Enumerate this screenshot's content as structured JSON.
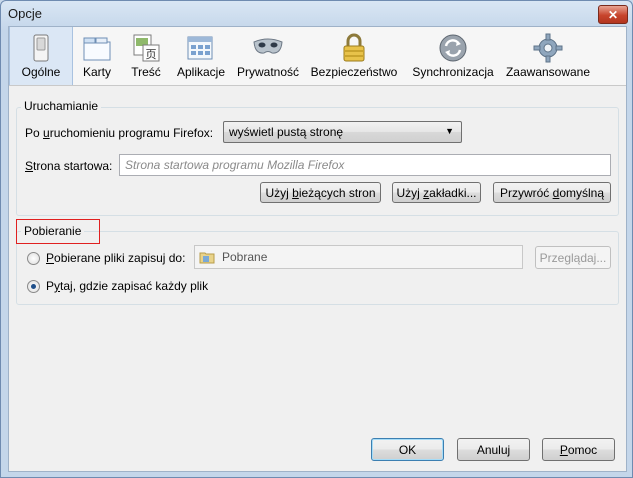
{
  "window": {
    "title": "Opcje"
  },
  "toolbar": {
    "panes": [
      {
        "label": "Ogólne",
        "icon": "switch-icon",
        "selected": true
      },
      {
        "label": "Karty",
        "icon": "tabs-icon"
      },
      {
        "label": "Treść",
        "icon": "content-icon"
      },
      {
        "label": "Aplikacje",
        "icon": "applications-icon"
      },
      {
        "label": "Prywatność",
        "icon": "mask-icon"
      },
      {
        "label": "Bezpieczeństwo",
        "icon": "padlock-icon"
      },
      {
        "label": "Synchronizacja",
        "icon": "sync-icon"
      },
      {
        "label": "Zaawansowane",
        "icon": "gear-icon"
      }
    ]
  },
  "startup": {
    "caption": "Uruchamianie",
    "when_starts_label": "Po uruchomieniu programu Firefox:",
    "when_starts_value": "wyświetl pustą stronę",
    "homepage_label": "Strona startowa:",
    "homepage_placeholder": "Strona startowa programu Mozilla Firefox",
    "use_current_label": "Użyj bieżących stron",
    "use_bookmark_label": "Użyj zakładki...",
    "restore_default_label": "Przywróć domyślną"
  },
  "downloads": {
    "caption": "Pobieranie",
    "save_to_label": "Pobierane pliki zapisuj do:",
    "folder_value": "Pobrane",
    "browse_label": "Przeglądaj...",
    "always_ask_label": "Pytaj, gdzie zapisać każdy plik",
    "selected_option": "always_ask"
  },
  "footer": {
    "ok_label": "OK",
    "cancel_label": "Anuluj",
    "help_label": "Pomoc"
  },
  "colors": {
    "highlight_border": "#e02020",
    "selected_pane_bg": "#dbe7f5"
  }
}
